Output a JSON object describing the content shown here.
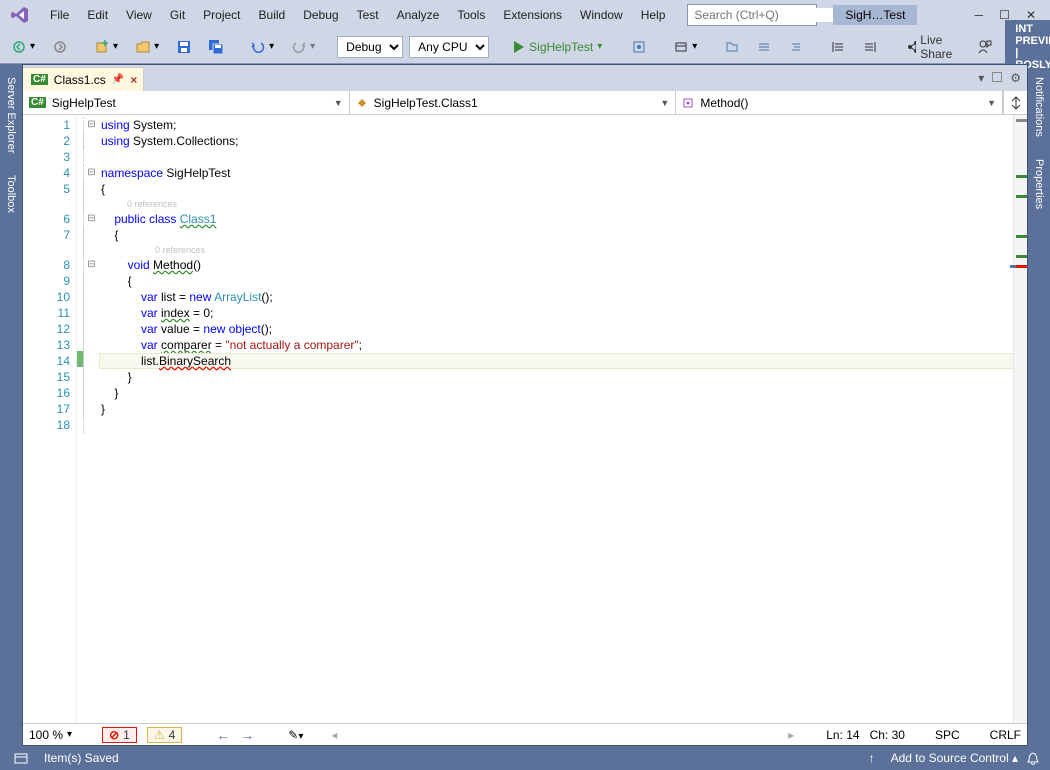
{
  "menu": [
    "File",
    "Edit",
    "View",
    "Git",
    "Project",
    "Build",
    "Debug",
    "Test",
    "Analyze",
    "Tools",
    "Extensions",
    "Window",
    "Help"
  ],
  "search_placeholder": "Search (Ctrl+Q)",
  "solution_title": "SigH…Test",
  "toolbar": {
    "config": "Debug",
    "platform": "Any CPU",
    "start_target": "SigHelpTest",
    "live_share": "Live Share",
    "preview": "INT PREVIEW | ROSLY…"
  },
  "side_tabs_left": [
    "Server Explorer",
    "Toolbox"
  ],
  "side_tabs_right": [
    "Notifications",
    "Properties"
  ],
  "tab": {
    "filename": "Class1.cs"
  },
  "nav": {
    "project": "SigHelpTest",
    "class": "SigHelpTest.Class1",
    "member": "Method()"
  },
  "code": {
    "lines": [
      1,
      2,
      3,
      4,
      5,
      6,
      7,
      8,
      9,
      10,
      11,
      12,
      13,
      14,
      15,
      16,
      17,
      18
    ],
    "ref0": "0 references",
    "l1": {
      "a": "using ",
      "b": "System",
      "c": ";"
    },
    "l2": {
      "a": "using ",
      "b": "System.Collections",
      "c": ";"
    },
    "l4": {
      "a": "namespace ",
      "b": "SigHelpTest"
    },
    "l5": "{",
    "l6": {
      "a": "    public class ",
      "b": "Class1"
    },
    "l7": "    {",
    "l8": {
      "a": "        void ",
      "b": "Method",
      "c": "()"
    },
    "l9": "        {",
    "l10": {
      "a": "            var ",
      "b": "list",
      "c": " = ",
      "d": "new ",
      "e": "ArrayList",
      "f": "();"
    },
    "l11": {
      "a": "            var ",
      "b": "index",
      "c": " = 0;"
    },
    "l12": {
      "a": "            var ",
      "b": "value",
      "c": " = ",
      "d": "new object",
      "e": "();"
    },
    "l13": {
      "a": "            var ",
      "b": "comparer",
      "c": " = ",
      "d": "\"not actually a comparer\"",
      "e": ";"
    },
    "l14": {
      "a": "            list.",
      "b": "BinarySearch"
    },
    "l15": "        }",
    "l16": "    }",
    "l17": "}"
  },
  "error_strip": {
    "zoom": "100 %",
    "errors": "1",
    "warnings": "4",
    "ln": "Ln: 14",
    "ch": "Ch: 30",
    "ws": "SPC",
    "eol": "CRLF"
  },
  "status": {
    "msg": "Item(s) Saved",
    "source_control": "Add to Source Control"
  }
}
